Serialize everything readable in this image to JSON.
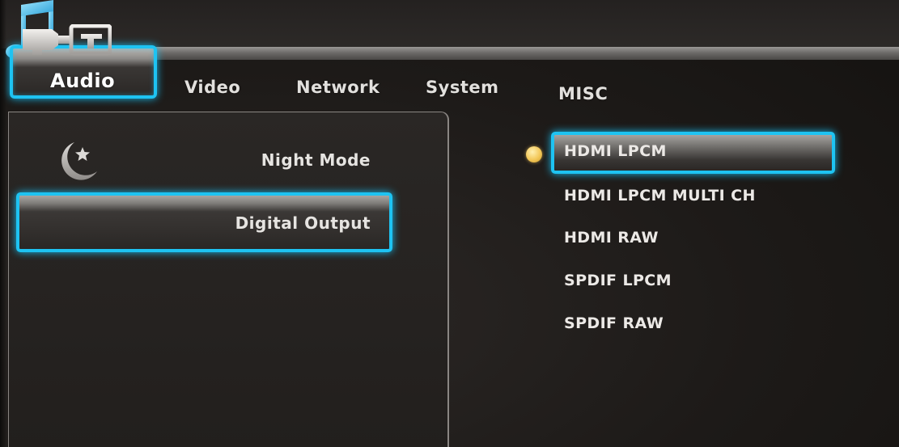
{
  "tabs": [
    {
      "label": "Audio",
      "active": true
    },
    {
      "label": "Video",
      "active": false
    },
    {
      "label": "Network",
      "active": false
    },
    {
      "label": "System",
      "active": false
    },
    {
      "label": "MISC",
      "active": false
    }
  ],
  "menu": {
    "items": [
      {
        "label": "Night Mode",
        "icon": "moon-star-icon",
        "selected": false
      },
      {
        "label": "Digital Output",
        "icon": "digital-output-icon",
        "selected": true
      }
    ]
  },
  "options": {
    "items": [
      {
        "label": "HDMI LPCM",
        "selected": true
      },
      {
        "label": "HDMI LPCM MULTI CH",
        "selected": false
      },
      {
        "label": "HDMI RAW",
        "selected": false
      },
      {
        "label": "SPDIF LPCM",
        "selected": false
      },
      {
        "label": "SPDIF RAW",
        "selected": false
      }
    ]
  },
  "colors": {
    "highlight": "#1ec3f2",
    "bullet": "#f3c758",
    "background": "#1d1a18"
  }
}
